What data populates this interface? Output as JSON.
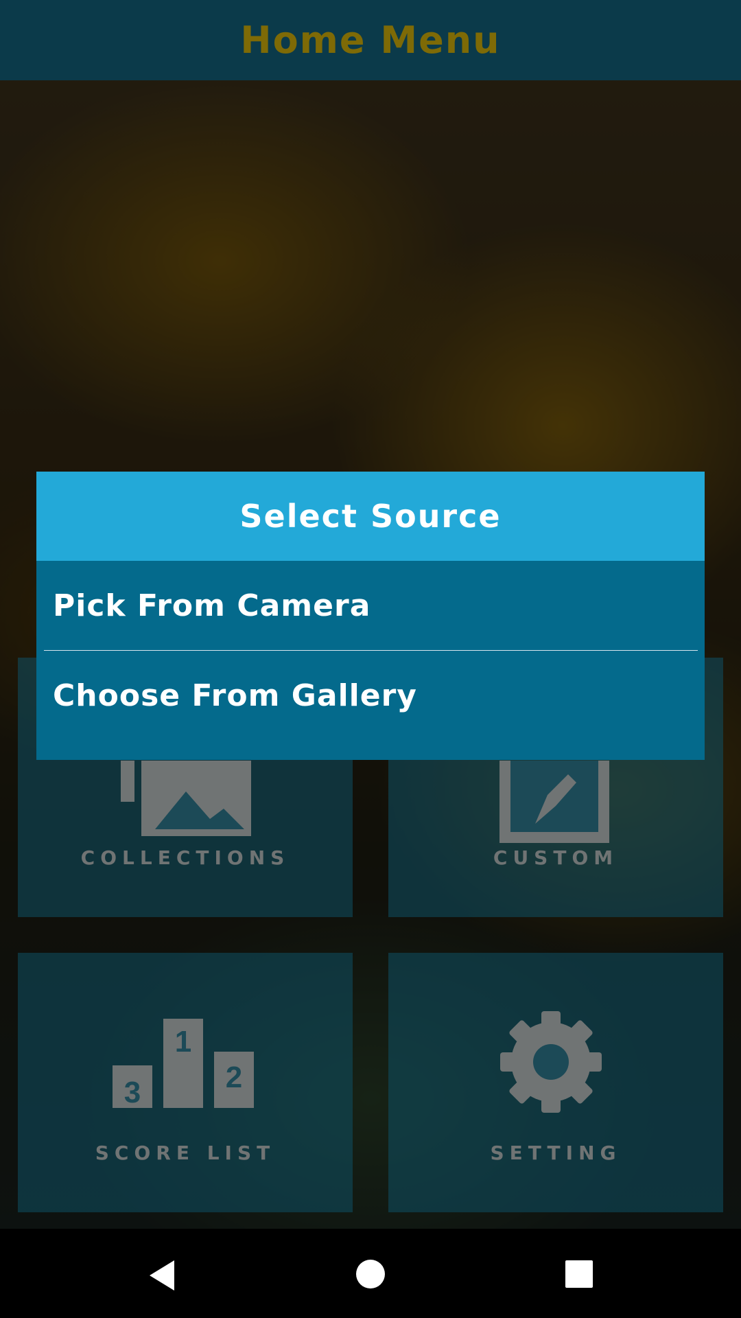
{
  "header": {
    "title": "Home Menu"
  },
  "tiles": [
    {
      "label": "COLLECTIONS",
      "icon": "image-icon"
    },
    {
      "label": "CUSTOM",
      "icon": "edit-icon"
    },
    {
      "label": "SCORE LIST",
      "icon": "podium-icon",
      "podium": [
        "3",
        "1",
        "2"
      ]
    },
    {
      "label": "SETTING",
      "icon": "gear-icon"
    }
  ],
  "dialog": {
    "title": "Select Source",
    "options": [
      "Pick From Camera",
      "Choose From Gallery"
    ]
  },
  "navbar": {
    "buttons": [
      "back-icon",
      "home-icon",
      "recents-icon"
    ]
  },
  "colors": {
    "header_bg": "#0b3a4a",
    "header_text": "#7e6a06",
    "dialog_title_bg": "#23a9d8",
    "dialog_bg": "#046a8c"
  }
}
